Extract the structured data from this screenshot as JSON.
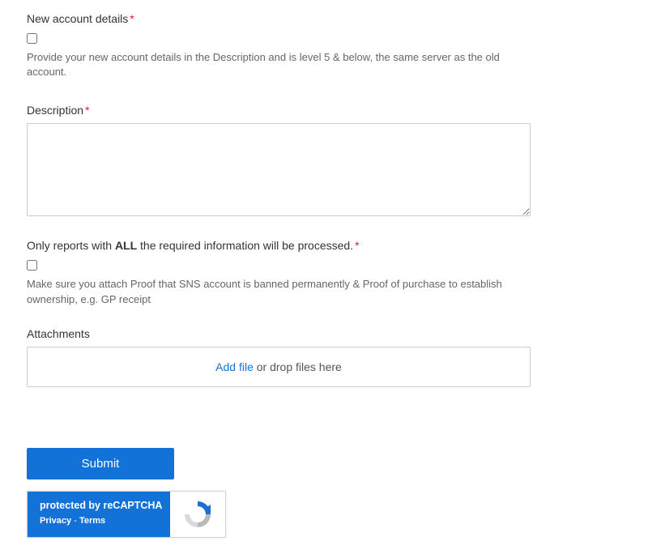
{
  "fields": {
    "newAccount": {
      "label": "New account details",
      "helper": "Provide your new account details in the Description and is level 5 & below, the same server as the old account."
    },
    "description": {
      "label": "Description"
    },
    "requirements": {
      "labelPrefix": "Only reports with ",
      "labelBold": "ALL",
      "labelSuffix": " the required information will be processed.",
      "helper": "Make sure you attach Proof that SNS account is banned permanently & Proof of purchase to establish ownership, e.g. GP receipt"
    },
    "attachments": {
      "label": "Attachments",
      "addFile": "Add file",
      "orDrop": " or drop files here"
    }
  },
  "submit": {
    "label": "Submit"
  },
  "recaptcha": {
    "title": "protected by reCAPTCHA",
    "privacy": "Privacy",
    "separator": " - ",
    "terms": "Terms"
  }
}
